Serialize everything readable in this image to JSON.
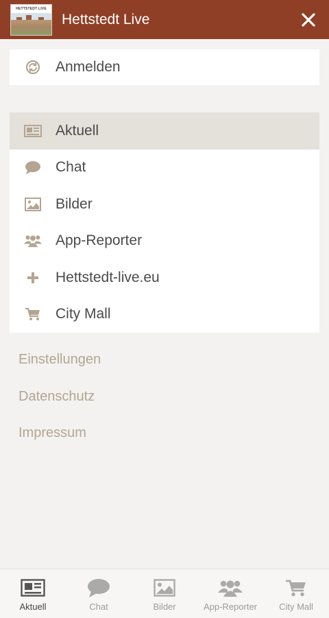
{
  "header": {
    "logo_text": "HETTSTEDT LIVE",
    "title": "Hettstedt Live",
    "close_icon": "close-icon"
  },
  "login": {
    "label": "Anmelden",
    "icon": "refresh-icon"
  },
  "nav": {
    "items": [
      {
        "label": "Aktuell",
        "icon": "newspaper-icon",
        "active": true
      },
      {
        "label": "Chat",
        "icon": "chat-bubble-icon",
        "active": false
      },
      {
        "label": "Bilder",
        "icon": "image-icon",
        "active": false
      },
      {
        "label": "App-Reporter",
        "icon": "users-icon",
        "active": false
      },
      {
        "label": "Hettstedt-live.eu",
        "icon": "plus-icon",
        "active": false
      },
      {
        "label": "City Mall",
        "icon": "cart-icon",
        "active": false
      }
    ]
  },
  "links": [
    "Einstellungen",
    "Datenschutz",
    "Impressum"
  ],
  "tabs": [
    {
      "label": "Aktuell",
      "icon": "newspaper-icon",
      "active": true
    },
    {
      "label": "Chat",
      "icon": "chat-bubble-icon",
      "active": false
    },
    {
      "label": "Bilder",
      "icon": "image-icon",
      "active": false
    },
    {
      "label": "App-Reporter",
      "icon": "users-icon",
      "active": false
    },
    {
      "label": "City Mall",
      "icon": "cart-icon",
      "active": false
    }
  ],
  "colors": {
    "header_bg": "#8f3f26",
    "page_bg": "#f3f2f0",
    "active_row": "#e4e0da",
    "link_text": "#b3a591",
    "icon_fill": "#b3a591"
  }
}
